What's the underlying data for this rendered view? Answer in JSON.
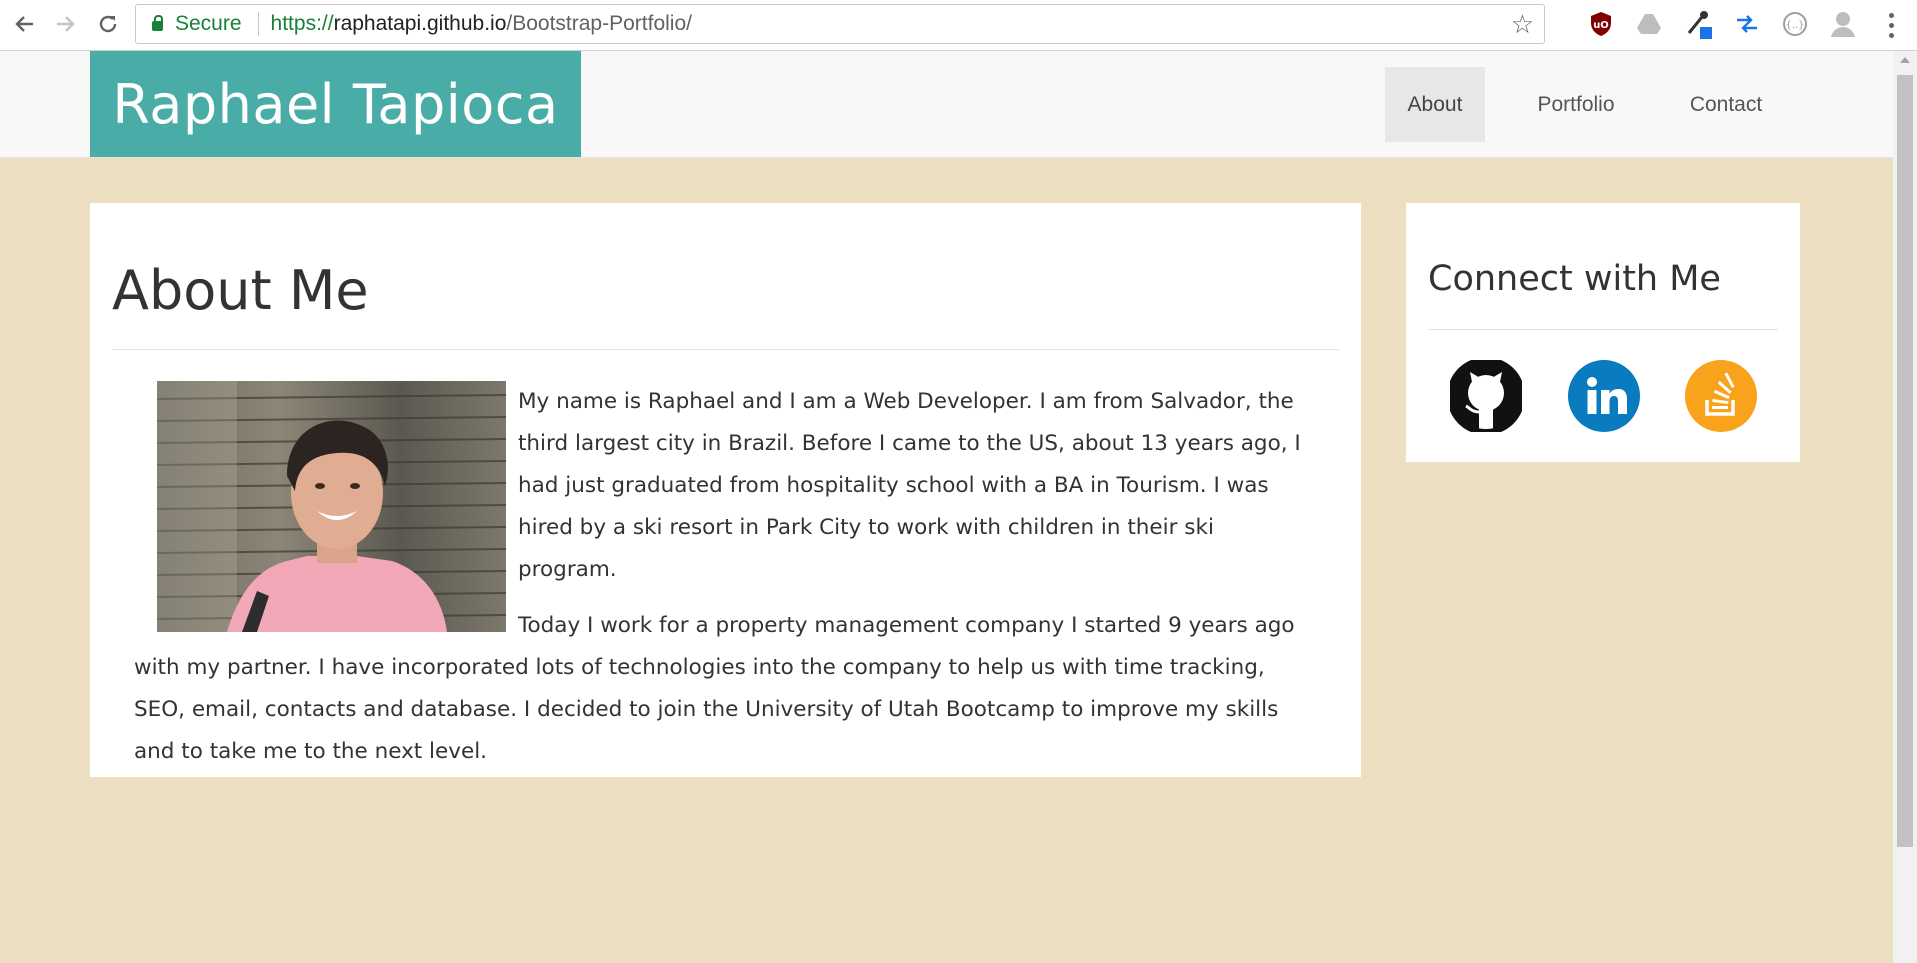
{
  "browser": {
    "secure_label": "Secure",
    "url_scheme": "https://",
    "url_host": "raphatapi.github.io",
    "url_path": "/Bootstrap-Portfolio/"
  },
  "site": {
    "brand": "Raphael Tapioca",
    "nav": [
      {
        "label": "About",
        "active": true
      },
      {
        "label": "Portfolio",
        "active": false
      },
      {
        "label": "Contact",
        "active": false
      }
    ]
  },
  "about": {
    "title": "About Me",
    "paragraphs": [
      "My name is Raphael and I am a Web Developer. I am from Salvador, the third largest city in Brazil. Before I came to the US, about 13 years ago, I had just graduated from hospitality school with a BA in Tourism. I was hired by a ski resort in Park City to work with children in their ski program.",
      "Today I work for a property management company I started 9 years ago with my partner. I have incorporated lots of technologies into the company to help us with time tracking, SEO, email, contacts and database. I decided to join the University of Utah Bootcamp to improve my skills and to take me to the next level."
    ]
  },
  "connect": {
    "title": "Connect with Me",
    "links": [
      {
        "icon": "github-icon",
        "color": "#111111"
      },
      {
        "icon": "linkedin-icon",
        "color": "#0a7bbf"
      },
      {
        "icon": "stackoverflow-icon",
        "color": "#f9a21b"
      }
    ]
  },
  "colors": {
    "brand": "#4aaca7",
    "page_background": "#ecdfc1"
  }
}
